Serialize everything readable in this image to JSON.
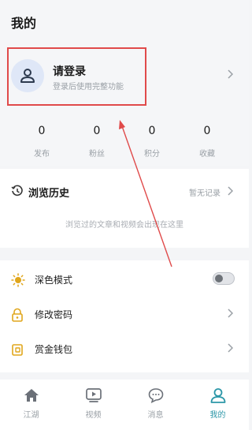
{
  "header": {
    "title": "我的"
  },
  "login": {
    "title": "请登录",
    "subtitle": "登录后使用完整功能"
  },
  "stats": [
    {
      "value": "0",
      "label": "发布"
    },
    {
      "value": "0",
      "label": "粉丝"
    },
    {
      "value": "0",
      "label": "积分"
    },
    {
      "value": "0",
      "label": "收藏"
    }
  ],
  "history": {
    "title": "浏览历史",
    "status": "暂无记录",
    "empty_text": "浏览过的文章和视频会出现在这里",
    "icon": "history-clock-icon"
  },
  "settings": {
    "dark_mode": {
      "label": "深色模式",
      "icon": "sun-icon",
      "enabled": false
    },
    "change_password": {
      "label": "修改密码",
      "icon": "lock-icon"
    },
    "wallet": {
      "label": "赏金钱包",
      "icon": "wallet-icon"
    }
  },
  "tabbar": [
    {
      "label": "江湖",
      "icon": "home-icon",
      "active": false
    },
    {
      "label": "视频",
      "icon": "video-icon",
      "active": false
    },
    {
      "label": "消息",
      "icon": "message-icon",
      "active": false
    },
    {
      "label": "我的",
      "icon": "user-icon",
      "active": true
    }
  ],
  "colors": {
    "accent": "#2c97a8",
    "annotation": "#e04a4a",
    "icon_gold": "#e0a61c"
  }
}
